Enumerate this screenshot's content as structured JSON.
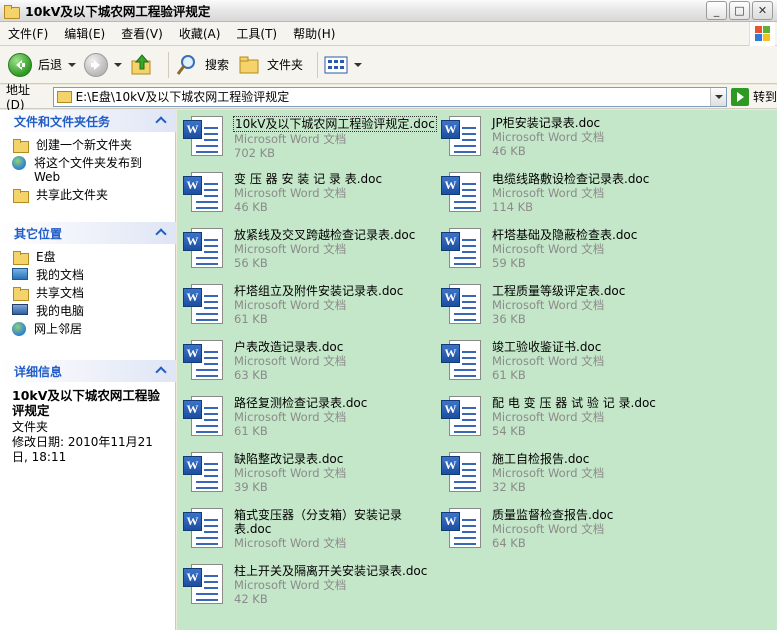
{
  "window": {
    "title": "10kV及以下城农网工程验评规定"
  },
  "menu": [
    "文件(F)",
    "编辑(E)",
    "查看(V)",
    "收藏(A)",
    "工具(T)",
    "帮助(H)"
  ],
  "toolbar": {
    "back": "后退",
    "search": "搜索",
    "folders": "文件夹"
  },
  "address": {
    "label": "地址(D)",
    "path": "E:\\E盘\\10kV及以下城农网工程验评规定",
    "go": "转到"
  },
  "tasks_panel": {
    "title": "文件和文件夹任务",
    "items": [
      "创建一个新文件夹",
      "将这个文件夹发布到 Web",
      "共享此文件夹"
    ]
  },
  "places_panel": {
    "title": "其它位置",
    "items": [
      "E盘",
      "我的文档",
      "共享文档",
      "我的电脑",
      "网上邻居"
    ]
  },
  "details_panel": {
    "title": "详细信息",
    "name": "10kV及以下城农网工程验评规定",
    "type": "文件夹",
    "modified": "修改日期: 2010年11月21日, 18:11"
  },
  "files": [
    {
      "name": "10kV及以下城农网工程验评规定.doc",
      "type": "Microsoft Word 文档",
      "size": "702 KB",
      "selected": true
    },
    {
      "name": "JP柜安装记录表.doc",
      "type": "Microsoft Word 文档",
      "size": "46 KB"
    },
    {
      "name": "变 压 器 安 装 记 录 表.doc",
      "type": "Microsoft Word 文档",
      "size": "46 KB"
    },
    {
      "name": "电缆线路敷设检查记录表.doc",
      "type": "Microsoft Word 文档",
      "size": "114 KB"
    },
    {
      "name": "放紧线及交叉跨越检查记录表.doc",
      "type": "Microsoft Word 文档",
      "size": "56 KB"
    },
    {
      "name": "杆塔基础及隐蔽检查表.doc",
      "type": "Microsoft Word 文档",
      "size": "59 KB"
    },
    {
      "name": "杆塔组立及附件安装记录表.doc",
      "type": "Microsoft Word 文档",
      "size": "61 KB"
    },
    {
      "name": "工程质量等级评定表.doc",
      "type": "Microsoft Word 文档",
      "size": "36 KB"
    },
    {
      "name": "户表改造记录表.doc",
      "type": "Microsoft Word 文档",
      "size": "63 KB"
    },
    {
      "name": "竣工验收鉴证书.doc",
      "type": "Microsoft Word 文档",
      "size": "61 KB"
    },
    {
      "name": "路径复测检查记录表.doc",
      "type": "Microsoft Word 文档",
      "size": "61 KB"
    },
    {
      "name": "配 电 变 压 器 试 验 记 录.doc",
      "type": "Microsoft Word 文档",
      "size": "54 KB"
    },
    {
      "name": "缺陷整改记录表.doc",
      "type": "Microsoft Word 文档",
      "size": "39 KB"
    },
    {
      "name": "施工自检报告.doc",
      "type": "Microsoft Word 文档",
      "size": "32 KB"
    },
    {
      "name": "箱式变压器（分支箱）安装记录表.doc",
      "type": "Microsoft Word 文档",
      "size": ""
    },
    {
      "name": "质量监督检查报告.doc",
      "type": "Microsoft Word 文档",
      "size": "64 KB"
    },
    {
      "name": "柱上开关及隔离开关安装记录表.doc",
      "type": "Microsoft Word 文档",
      "size": "42 KB"
    }
  ]
}
